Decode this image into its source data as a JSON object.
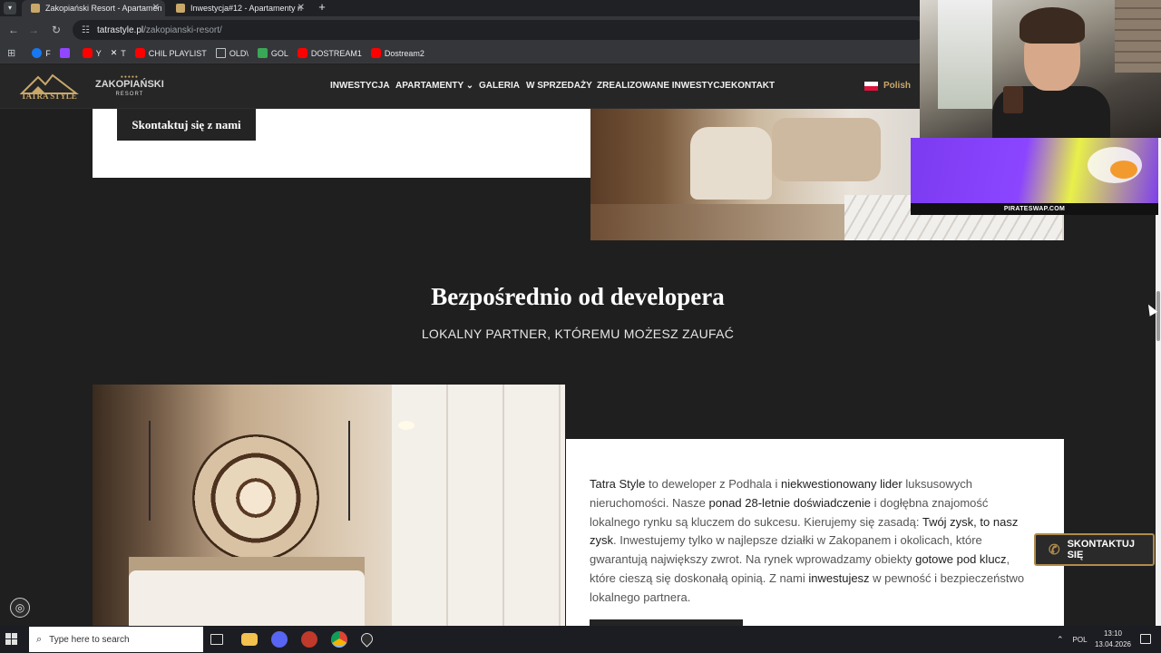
{
  "browser": {
    "tabs": [
      {
        "title": "Zakopiański Resort - Apartamen",
        "active": true
      },
      {
        "title": "Inwestycja#12 - Apartamenty n",
        "active": false
      }
    ],
    "new_tab_label": "+",
    "url_domain": "tatrastyle.pl",
    "url_path": "/zakopianski-resort/",
    "bookmarks": [
      {
        "label": "F",
        "color": "#1877f2"
      },
      {
        "label": "",
        "color": "#9146ff"
      },
      {
        "label": "Y",
        "color": "#ff0000"
      },
      {
        "label": "T",
        "color": "#ffffff"
      },
      {
        "label": "CHIL PLAYLIST",
        "color": "#ff0000"
      },
      {
        "label": "OLD\\",
        "color": "#bdc1c6"
      },
      {
        "label": "GOL",
        "color": "#3aa757"
      },
      {
        "label": "DOSTREAM1",
        "color": "#ff0000"
      },
      {
        "label": "Dostream2",
        "color": "#ff0000"
      }
    ]
  },
  "site": {
    "logo_brand": "TATRA STYLE",
    "logo_resort_main": "ZAKOPIAŃSKI",
    "logo_resort_sub": "RESORT",
    "menu": [
      "INWESTYCJA",
      "APARTAMENTY",
      "GALERIA",
      "W SPRZEDAŻY",
      "ZREALIZOWANE INWESTYCJE",
      "KONTAKT"
    ],
    "language": "Polish",
    "contact_button": "Skontaktuj się z nami",
    "headline": "Bezpośrednio od developera",
    "subheadline": "LOKALNY PARTNER, KTÓREMU MOŻESZ ZAUFAĆ",
    "body_segments": [
      {
        "text": "Tatra Style",
        "strong": true
      },
      {
        "text": " to deweloper z Podhala i ",
        "strong": false
      },
      {
        "text": "niekwestionowany lider",
        "strong": true
      },
      {
        "text": " luksusowych nieruchomości. Nasze ",
        "strong": false
      },
      {
        "text": "ponad 28-letnie doświadczenie",
        "strong": true
      },
      {
        "text": " i dogłębna znajomość lokalnego rynku są kluczem do sukcesu. Kierujemy się zasadą: ",
        "strong": false
      },
      {
        "text": "Twój zysk, to nasz zysk",
        "strong": true
      },
      {
        "text": ". Inwestujemy tylko w najlepsze działki w Zakopanem i okolicach, które gwarantują największy zwrot. Na rynek wprowadzamy obiekty ",
        "strong": false
      },
      {
        "text": "gotowe pod klucz",
        "strong": true
      },
      {
        "text": ", które cieszą się doskonałą opinią. Z nami ",
        "strong": false
      },
      {
        "text": "inwestujesz",
        "strong": true
      },
      {
        "text": " w pewność i bezpieczeństwo lokalnego partnera.",
        "strong": false
      }
    ],
    "floating_contact": "SKONTAKTUJ SIĘ",
    "accent_color": "#b18b4c"
  },
  "overlay": {
    "ad_caption": "PIRATESWAP.COM"
  },
  "taskbar": {
    "search_placeholder": "Type here to search",
    "language": "POL",
    "time": "13:10",
    "date": "13.04.2026"
  }
}
